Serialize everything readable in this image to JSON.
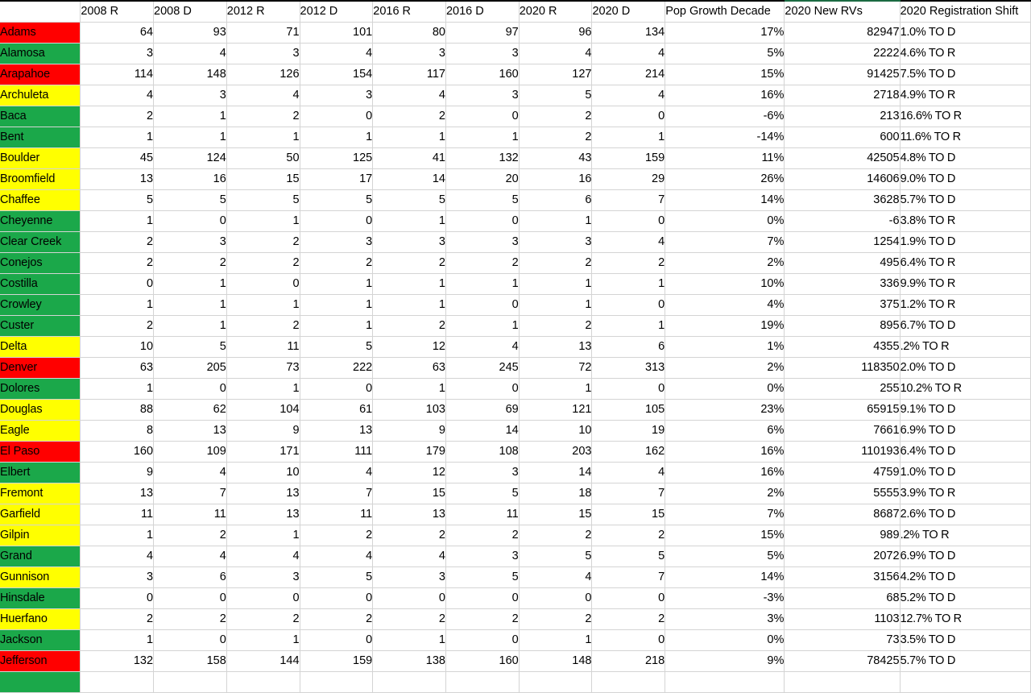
{
  "table": {
    "columns": [
      {
        "key": "county",
        "label": "",
        "name": "col-county"
      },
      {
        "key": "r2008",
        "label": "2008 R",
        "name": "col-2008-r"
      },
      {
        "key": "d2008",
        "label": "2008 D",
        "name": "col-2008-d"
      },
      {
        "key": "r2012",
        "label": "2012 R",
        "name": "col-2012-r"
      },
      {
        "key": "d2012",
        "label": "2012 D",
        "name": "col-2012-d"
      },
      {
        "key": "r2016",
        "label": "2016 R",
        "name": "col-2016-r"
      },
      {
        "key": "d2016",
        "label": "2016 D",
        "name": "col-2016-d"
      },
      {
        "key": "r2020",
        "label": "2020 R",
        "name": "col-2020-r"
      },
      {
        "key": "d2020",
        "label": "2020 D",
        "name": "col-2020-d"
      },
      {
        "key": "popgrowth",
        "label": "Pop Growth Decade",
        "name": "col-pop-growth-decade"
      },
      {
        "key": "newrvs",
        "label": "2020 New RVs",
        "name": "col-2020-new-rvs"
      },
      {
        "key": "shift",
        "label": "2020 Registration Shift",
        "name": "col-2020-registration-shift"
      }
    ],
    "colors": {
      "red": "#FF0000",
      "green": "#1BA84A",
      "yellow": "#FFFF00",
      "shift_to_d": "#1F6FB5",
      "shift_to_r": "#CC0000",
      "header_top_border": "#000000",
      "new_rvs_top_border": "#1b6b42"
    },
    "rows": [
      {
        "county": "Adams",
        "fill": "red",
        "r2008": "64",
        "d2008": "93",
        "r2012": "71",
        "d2012": "101",
        "r2016": "80",
        "d2016": "97",
        "r2020": "96",
        "d2020": "134",
        "popgrowth": "17%",
        "newrvs": "82947",
        "shift": "1.0% TO D",
        "shift_dir": "D"
      },
      {
        "county": "Alamosa",
        "fill": "green",
        "r2008": "3",
        "d2008": "4",
        "r2012": "3",
        "d2012": "4",
        "r2016": "3",
        "d2016": "3",
        "r2020": "4",
        "d2020": "4",
        "popgrowth": "5%",
        "newrvs": "2222",
        "shift": "4.6% TO R",
        "shift_dir": "R"
      },
      {
        "county": "Arapahoe",
        "fill": "red",
        "r2008": "114",
        "d2008": "148",
        "r2012": "126",
        "d2012": "154",
        "r2016": "117",
        "d2016": "160",
        "r2020": "127",
        "d2020": "214",
        "popgrowth": "15%",
        "newrvs": "91425",
        "shift": "7.5% TO D",
        "shift_dir": "D"
      },
      {
        "county": "Archuleta",
        "fill": "yellow",
        "r2008": "4",
        "d2008": "3",
        "r2012": "4",
        "d2012": "3",
        "r2016": "4",
        "d2016": "3",
        "r2020": "5",
        "d2020": "4",
        "popgrowth": "16%",
        "newrvs": "2718",
        "shift": "4.9% TO R",
        "shift_dir": "R"
      },
      {
        "county": "Baca",
        "fill": "green",
        "r2008": "2",
        "d2008": "1",
        "r2012": "2",
        "d2012": "0",
        "r2016": "2",
        "d2016": "0",
        "r2020": "2",
        "d2020": "0",
        "popgrowth": "-6%",
        "newrvs": "213",
        "shift": "16.6% TO R",
        "shift_dir": "R"
      },
      {
        "county": "Bent",
        "fill": "green",
        "r2008": "1",
        "d2008": "1",
        "r2012": "1",
        "d2012": "1",
        "r2016": "1",
        "d2016": "1",
        "r2020": "2",
        "d2020": "1",
        "popgrowth": "-14%",
        "newrvs": "600",
        "shift": "11.6% TO R",
        "shift_dir": "R"
      },
      {
        "county": "Boulder",
        "fill": "yellow",
        "r2008": "45",
        "d2008": "124",
        "r2012": "50",
        "d2012": "125",
        "r2016": "41",
        "d2016": "132",
        "r2020": "43",
        "d2020": "159",
        "popgrowth": "11%",
        "newrvs": "42505",
        "shift": "4.8% TO D",
        "shift_dir": "D"
      },
      {
        "county": "Broomfield",
        "fill": "yellow",
        "r2008": "13",
        "d2008": "16",
        "r2012": "15",
        "d2012": "17",
        "r2016": "14",
        "d2016": "20",
        "r2020": "16",
        "d2020": "29",
        "popgrowth": "26%",
        "newrvs": "14606",
        "shift": "9.0% TO D",
        "shift_dir": "D"
      },
      {
        "county": "Chaffee",
        "fill": "yellow",
        "r2008": "5",
        "d2008": "5",
        "r2012": "5",
        "d2012": "5",
        "r2016": "5",
        "d2016": "5",
        "r2020": "6",
        "d2020": "7",
        "popgrowth": "14%",
        "newrvs": "3628",
        "shift": "5.7% TO D",
        "shift_dir": "D"
      },
      {
        "county": "Cheyenne",
        "fill": "green",
        "r2008": "1",
        "d2008": "0",
        "r2012": "1",
        "d2012": "0",
        "r2016": "1",
        "d2016": "0",
        "r2020": "1",
        "d2020": "0",
        "popgrowth": "0%",
        "newrvs": "-6",
        "shift": "3.8% TO R",
        "shift_dir": "R"
      },
      {
        "county": "Clear Creek",
        "fill": "green",
        "r2008": "2",
        "d2008": "3",
        "r2012": "2",
        "d2012": "3",
        "r2016": "3",
        "d2016": "3",
        "r2020": "3",
        "d2020": "4",
        "popgrowth": "7%",
        "newrvs": "1254",
        "shift": "1.9% TO D",
        "shift_dir": "D"
      },
      {
        "county": "Conejos",
        "fill": "green",
        "r2008": "2",
        "d2008": "2",
        "r2012": "2",
        "d2012": "2",
        "r2016": "2",
        "d2016": "2",
        "r2020": "2",
        "d2020": "2",
        "popgrowth": "2%",
        "newrvs": "495",
        "shift": "6.4% TO R",
        "shift_dir": "R"
      },
      {
        "county": "Costilla",
        "fill": "green",
        "r2008": "0",
        "d2008": "1",
        "r2012": "0",
        "d2012": "1",
        "r2016": "1",
        "d2016": "1",
        "r2020": "1",
        "d2020": "1",
        "popgrowth": "10%",
        "newrvs": "336",
        "shift": "9.9% TO R",
        "shift_dir": "R"
      },
      {
        "county": "Crowley",
        "fill": "green",
        "r2008": "1",
        "d2008": "1",
        "r2012": "1",
        "d2012": "1",
        "r2016": "1",
        "d2016": "0",
        "r2020": "1",
        "d2020": "0",
        "popgrowth": "4%",
        "newrvs": "375",
        "shift": "1.2% TO R",
        "shift_dir": "R"
      },
      {
        "county": "Custer",
        "fill": "green",
        "r2008": "2",
        "d2008": "1",
        "r2012": "2",
        "d2012": "1",
        "r2016": "2",
        "d2016": "1",
        "r2020": "2",
        "d2020": "1",
        "popgrowth": "19%",
        "newrvs": "895",
        "shift": "6.7% TO D",
        "shift_dir": "D"
      },
      {
        "county": "Delta",
        "fill": "yellow",
        "r2008": "10",
        "d2008": "5",
        "r2012": "11",
        "d2012": "5",
        "r2016": "12",
        "d2016": "4",
        "r2020": "13",
        "d2020": "6",
        "popgrowth": "1%",
        "newrvs": "4355",
        "shift": ".2% TO R",
        "shift_dir": "R"
      },
      {
        "county": "Denver",
        "fill": "red",
        "r2008": "63",
        "d2008": "205",
        "r2012": "73",
        "d2012": "222",
        "r2016": "63",
        "d2016": "245",
        "r2020": "72",
        "d2020": "313",
        "popgrowth": "2%",
        "newrvs": "118350",
        "shift": "2.0% TO D",
        "shift_dir": "D"
      },
      {
        "county": "Dolores",
        "fill": "green",
        "r2008": "1",
        "d2008": "0",
        "r2012": "1",
        "d2012": "0",
        "r2016": "1",
        "d2016": "0",
        "r2020": "1",
        "d2020": "0",
        "popgrowth": "0%",
        "newrvs": "255",
        "shift": "10.2% TO R",
        "shift_dir": "R"
      },
      {
        "county": "Douglas",
        "fill": "yellow",
        "r2008": "88",
        "d2008": "62",
        "r2012": "104",
        "d2012": "61",
        "r2016": "103",
        "d2016": "69",
        "r2020": "121",
        "d2020": "105",
        "popgrowth": "23%",
        "newrvs": "65915",
        "shift": "9.1% TO D",
        "shift_dir": "D"
      },
      {
        "county": "Eagle",
        "fill": "yellow",
        "r2008": "8",
        "d2008": "13",
        "r2012": "9",
        "d2012": "13",
        "r2016": "9",
        "d2016": "14",
        "r2020": "10",
        "d2020": "19",
        "popgrowth": "6%",
        "newrvs": "7661",
        "shift": "6.9% TO D",
        "shift_dir": "D"
      },
      {
        "county": "El Paso",
        "fill": "red",
        "r2008": "160",
        "d2008": "109",
        "r2012": "171",
        "d2012": "111",
        "r2016": "179",
        "d2016": "108",
        "r2020": "203",
        "d2020": "162",
        "popgrowth": "16%",
        "newrvs": "110193",
        "shift": "6.4% TO D",
        "shift_dir": "D"
      },
      {
        "county": "Elbert",
        "fill": "green",
        "r2008": "9",
        "d2008": "4",
        "r2012": "10",
        "d2012": "4",
        "r2016": "12",
        "d2016": "3",
        "r2020": "14",
        "d2020": "4",
        "popgrowth": "16%",
        "newrvs": "4759",
        "shift": "1.0% TO D",
        "shift_dir": "D"
      },
      {
        "county": "Fremont",
        "fill": "yellow",
        "r2008": "13",
        "d2008": "7",
        "r2012": "13",
        "d2012": "7",
        "r2016": "15",
        "d2016": "5",
        "r2020": "18",
        "d2020": "7",
        "popgrowth": "2%",
        "newrvs": "5555",
        "shift": "3.9% TO R",
        "shift_dir": "R"
      },
      {
        "county": "Garfield",
        "fill": "yellow",
        "r2008": "11",
        "d2008": "11",
        "r2012": "13",
        "d2012": "11",
        "r2016": "13",
        "d2016": "11",
        "r2020": "15",
        "d2020": "15",
        "popgrowth": "7%",
        "newrvs": "8687",
        "shift": "2.6% TO D",
        "shift_dir": "D"
      },
      {
        "county": "Gilpin",
        "fill": "yellow",
        "r2008": "1",
        "d2008": "2",
        "r2012": "1",
        "d2012": "2",
        "r2016": "2",
        "d2016": "2",
        "r2020": "2",
        "d2020": "2",
        "popgrowth": "15%",
        "newrvs": "989",
        "shift": ".2% TO R",
        "shift_dir": "R"
      },
      {
        "county": "Grand",
        "fill": "green",
        "r2008": "4",
        "d2008": "4",
        "r2012": "4",
        "d2012": "4",
        "r2016": "4",
        "d2016": "3",
        "r2020": "5",
        "d2020": "5",
        "popgrowth": "5%",
        "newrvs": "2072",
        "shift": "6.9% TO D",
        "shift_dir": "D"
      },
      {
        "county": "Gunnison",
        "fill": "yellow",
        "r2008": "3",
        "d2008": "6",
        "r2012": "3",
        "d2012": "5",
        "r2016": "3",
        "d2016": "5",
        "r2020": "4",
        "d2020": "7",
        "popgrowth": "14%",
        "newrvs": "3156",
        "shift": "4.2% TO D",
        "shift_dir": "D"
      },
      {
        "county": "Hinsdale",
        "fill": "green",
        "r2008": "0",
        "d2008": "0",
        "r2012": "0",
        "d2012": "0",
        "r2016": "0",
        "d2016": "0",
        "r2020": "0",
        "d2020": "0",
        "popgrowth": "-3%",
        "newrvs": "68",
        "shift": "5.2% TO D",
        "shift_dir": "D"
      },
      {
        "county": "Huerfano",
        "fill": "yellow",
        "r2008": "2",
        "d2008": "2",
        "r2012": "2",
        "d2012": "2",
        "r2016": "2",
        "d2016": "2",
        "r2020": "2",
        "d2020": "2",
        "popgrowth": "3%",
        "newrvs": "1103",
        "shift": "12.7% TO R",
        "shift_dir": "R"
      },
      {
        "county": "Jackson",
        "fill": "green",
        "r2008": "1",
        "d2008": "0",
        "r2012": "1",
        "d2012": "0",
        "r2016": "1",
        "d2016": "0",
        "r2020": "1",
        "d2020": "0",
        "popgrowth": "0%",
        "newrvs": "73",
        "shift": "3.5% TO D",
        "shift_dir": "D"
      },
      {
        "county": "Jefferson",
        "fill": "red",
        "r2008": "132",
        "d2008": "158",
        "r2012": "144",
        "d2012": "159",
        "r2016": "138",
        "d2016": "160",
        "r2020": "148",
        "d2020": "218",
        "popgrowth": "9%",
        "newrvs": "78425",
        "shift": "5.7% TO D",
        "shift_dir": "D"
      }
    ],
    "clipped_row": {
      "county": "",
      "fill": "green"
    }
  }
}
